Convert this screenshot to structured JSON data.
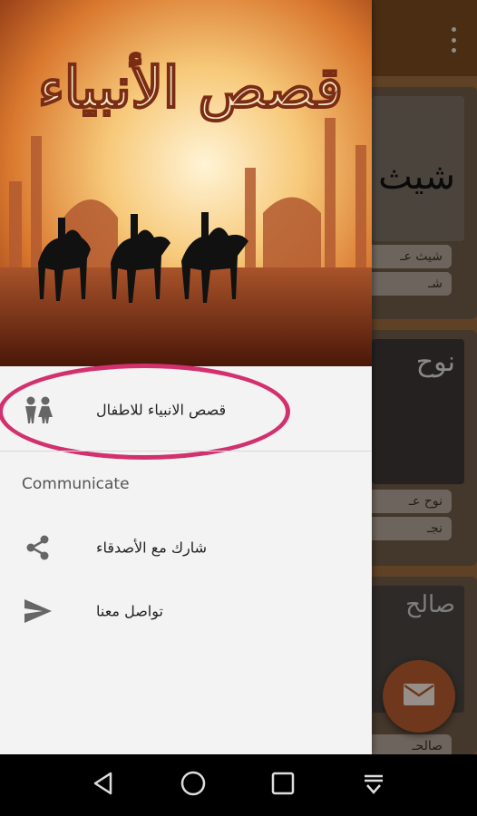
{
  "background": {
    "cards": [
      {
        "thumb_title": "شيث",
        "label1": "شيث عـ",
        "label2": "شـ"
      },
      {
        "thumb_title": "نوح",
        "label1": "نوح عـ",
        "label2": "نجـ"
      },
      {
        "thumb_title": "صالح",
        "label1": "صالحـ",
        "label2": ""
      }
    ],
    "fab_icon": "email-icon"
  },
  "drawer": {
    "header_title": "قصص الأنبياء",
    "items": [
      {
        "icon": "children-icon",
        "label": "قصص الانبياء للاطفال"
      }
    ],
    "section_header": "Communicate",
    "communicate_items": [
      {
        "icon": "share-icon",
        "label": "شارك مع الأصدقاء"
      },
      {
        "icon": "send-icon",
        "label": "تواصل معنا"
      }
    ]
  },
  "colors": {
    "drawer_bg": "#f3f3f3",
    "highlight": "#d2306e",
    "fab": "#b35a2c",
    "toolbar": "#7a4a1f"
  },
  "system_nav": {
    "buttons": [
      "back-icon",
      "home-icon",
      "recents-icon",
      "notification-pull-icon"
    ]
  }
}
